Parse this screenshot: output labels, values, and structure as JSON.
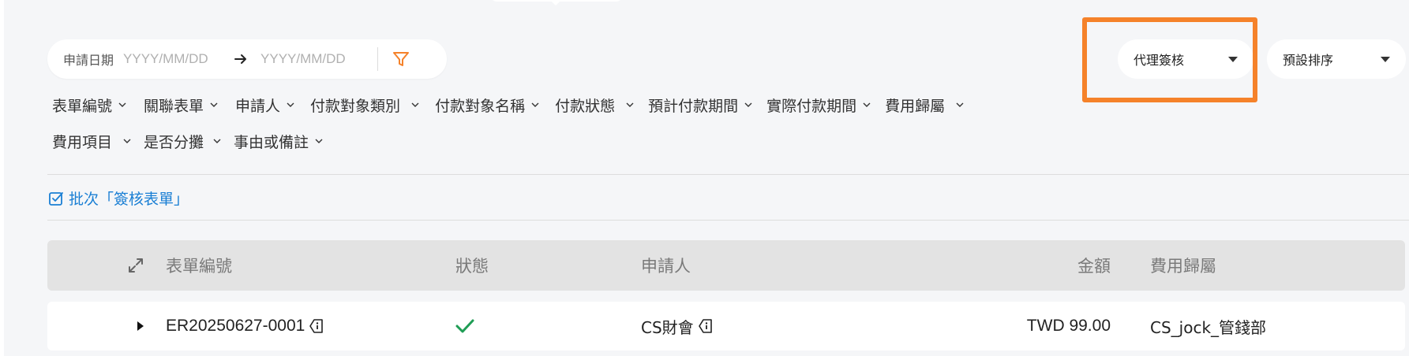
{
  "date_filter": {
    "label": "申請日期",
    "start_placeholder": "YYYY/MM/DD",
    "end_placeholder": "YYYY/MM/DD"
  },
  "selects": {
    "delegate": "代理簽核",
    "sort": "預設排序"
  },
  "filters_row1": [
    "表單編號",
    "關聯表單",
    "申請人",
    "付款對象類別",
    "付款對象名稱",
    "付款狀態",
    "預計付款期間",
    "實際付款期間",
    "費用歸屬"
  ],
  "filters_row2": [
    "費用項目",
    "是否分攤",
    "事由或備註"
  ],
  "batch_action": "批次「簽核表單」",
  "table": {
    "headers": {
      "id": "表單編號",
      "status": "狀態",
      "applicant": "申請人",
      "amount": "金額",
      "owner": "費用歸屬"
    },
    "rows": [
      {
        "id": "ER20250627-0001",
        "status_icon": "check-icon",
        "applicant": "CS財會",
        "amount": "TWD 99.00",
        "owner": "CS_jock_管錢部"
      }
    ]
  },
  "colors": {
    "accent": "#f5822a",
    "link": "#1a7fd4",
    "success": "#1f9d55"
  }
}
